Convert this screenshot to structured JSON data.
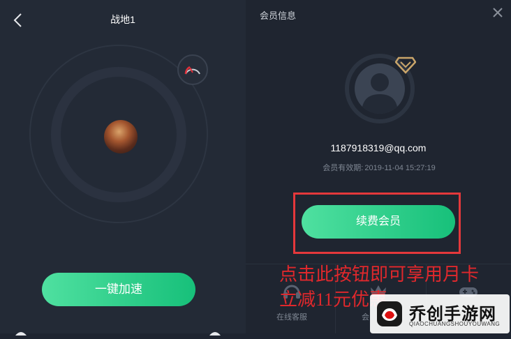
{
  "left_panel": {
    "game_title": "战地1",
    "accelerate_button": "一键加速"
  },
  "right_panel": {
    "title": "会员信息",
    "email": "1187918319@qq.com",
    "expiry_label": "会员有效期:",
    "expiry_value": "2019-11-04 15:27:19",
    "renew_button": "续费会员",
    "bottom_items": [
      {
        "label": "在线客服"
      },
      {
        "label": "会"
      }
    ]
  },
  "annotation": {
    "line1": "点击此按钮即可享用月卡",
    "line2": "立减11元优惠"
  },
  "watermark": {
    "name": "乔创手游网",
    "url": "QIAOCHUANGSHOUYOUWANG"
  },
  "colors": {
    "accent_green": "#17c07a",
    "highlight_red": "#e5383b",
    "diamond_gold": "#c9a56a"
  },
  "icons": [
    "back-chevron-icon",
    "speedometer-icon",
    "close-icon",
    "diamond-icon",
    "user-silhouette-icon",
    "headset-icon",
    "vip-crown-icon",
    "gamepad-icon"
  ]
}
